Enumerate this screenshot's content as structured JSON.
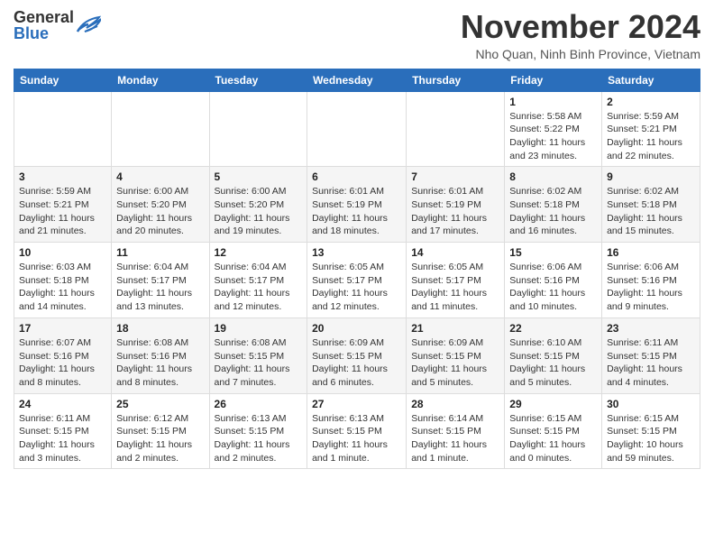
{
  "header": {
    "logo_general": "General",
    "logo_blue": "Blue",
    "month_year": "November 2024",
    "location": "Nho Quan, Ninh Binh Province, Vietnam"
  },
  "calendar": {
    "days_of_week": [
      "Sunday",
      "Monday",
      "Tuesday",
      "Wednesday",
      "Thursday",
      "Friday",
      "Saturday"
    ],
    "weeks": [
      [
        {
          "day": "",
          "info": ""
        },
        {
          "day": "",
          "info": ""
        },
        {
          "day": "",
          "info": ""
        },
        {
          "day": "",
          "info": ""
        },
        {
          "day": "",
          "info": ""
        },
        {
          "day": "1",
          "info": "Sunrise: 5:58 AM\nSunset: 5:22 PM\nDaylight: 11 hours\nand 23 minutes."
        },
        {
          "day": "2",
          "info": "Sunrise: 5:59 AM\nSunset: 5:21 PM\nDaylight: 11 hours\nand 22 minutes."
        }
      ],
      [
        {
          "day": "3",
          "info": "Sunrise: 5:59 AM\nSunset: 5:21 PM\nDaylight: 11 hours\nand 21 minutes."
        },
        {
          "day": "4",
          "info": "Sunrise: 6:00 AM\nSunset: 5:20 PM\nDaylight: 11 hours\nand 20 minutes."
        },
        {
          "day": "5",
          "info": "Sunrise: 6:00 AM\nSunset: 5:20 PM\nDaylight: 11 hours\nand 19 minutes."
        },
        {
          "day": "6",
          "info": "Sunrise: 6:01 AM\nSunset: 5:19 PM\nDaylight: 11 hours\nand 18 minutes."
        },
        {
          "day": "7",
          "info": "Sunrise: 6:01 AM\nSunset: 5:19 PM\nDaylight: 11 hours\nand 17 minutes."
        },
        {
          "day": "8",
          "info": "Sunrise: 6:02 AM\nSunset: 5:18 PM\nDaylight: 11 hours\nand 16 minutes."
        },
        {
          "day": "9",
          "info": "Sunrise: 6:02 AM\nSunset: 5:18 PM\nDaylight: 11 hours\nand 15 minutes."
        }
      ],
      [
        {
          "day": "10",
          "info": "Sunrise: 6:03 AM\nSunset: 5:18 PM\nDaylight: 11 hours\nand 14 minutes."
        },
        {
          "day": "11",
          "info": "Sunrise: 6:04 AM\nSunset: 5:17 PM\nDaylight: 11 hours\nand 13 minutes."
        },
        {
          "day": "12",
          "info": "Sunrise: 6:04 AM\nSunset: 5:17 PM\nDaylight: 11 hours\nand 12 minutes."
        },
        {
          "day": "13",
          "info": "Sunrise: 6:05 AM\nSunset: 5:17 PM\nDaylight: 11 hours\nand 12 minutes."
        },
        {
          "day": "14",
          "info": "Sunrise: 6:05 AM\nSunset: 5:17 PM\nDaylight: 11 hours\nand 11 minutes."
        },
        {
          "day": "15",
          "info": "Sunrise: 6:06 AM\nSunset: 5:16 PM\nDaylight: 11 hours\nand 10 minutes."
        },
        {
          "day": "16",
          "info": "Sunrise: 6:06 AM\nSunset: 5:16 PM\nDaylight: 11 hours\nand 9 minutes."
        }
      ],
      [
        {
          "day": "17",
          "info": "Sunrise: 6:07 AM\nSunset: 5:16 PM\nDaylight: 11 hours\nand 8 minutes."
        },
        {
          "day": "18",
          "info": "Sunrise: 6:08 AM\nSunset: 5:16 PM\nDaylight: 11 hours\nand 8 minutes."
        },
        {
          "day": "19",
          "info": "Sunrise: 6:08 AM\nSunset: 5:15 PM\nDaylight: 11 hours\nand 7 minutes."
        },
        {
          "day": "20",
          "info": "Sunrise: 6:09 AM\nSunset: 5:15 PM\nDaylight: 11 hours\nand 6 minutes."
        },
        {
          "day": "21",
          "info": "Sunrise: 6:09 AM\nSunset: 5:15 PM\nDaylight: 11 hours\nand 5 minutes."
        },
        {
          "day": "22",
          "info": "Sunrise: 6:10 AM\nSunset: 5:15 PM\nDaylight: 11 hours\nand 5 minutes."
        },
        {
          "day": "23",
          "info": "Sunrise: 6:11 AM\nSunset: 5:15 PM\nDaylight: 11 hours\nand 4 minutes."
        }
      ],
      [
        {
          "day": "24",
          "info": "Sunrise: 6:11 AM\nSunset: 5:15 PM\nDaylight: 11 hours\nand 3 minutes."
        },
        {
          "day": "25",
          "info": "Sunrise: 6:12 AM\nSunset: 5:15 PM\nDaylight: 11 hours\nand 2 minutes."
        },
        {
          "day": "26",
          "info": "Sunrise: 6:13 AM\nSunset: 5:15 PM\nDaylight: 11 hours\nand 2 minutes."
        },
        {
          "day": "27",
          "info": "Sunrise: 6:13 AM\nSunset: 5:15 PM\nDaylight: 11 hours\nand 1 minute."
        },
        {
          "day": "28",
          "info": "Sunrise: 6:14 AM\nSunset: 5:15 PM\nDaylight: 11 hours\nand 1 minute."
        },
        {
          "day": "29",
          "info": "Sunrise: 6:15 AM\nSunset: 5:15 PM\nDaylight: 11 hours\nand 0 minutes."
        },
        {
          "day": "30",
          "info": "Sunrise: 6:15 AM\nSunset: 5:15 PM\nDaylight: 10 hours\nand 59 minutes."
        }
      ]
    ]
  }
}
